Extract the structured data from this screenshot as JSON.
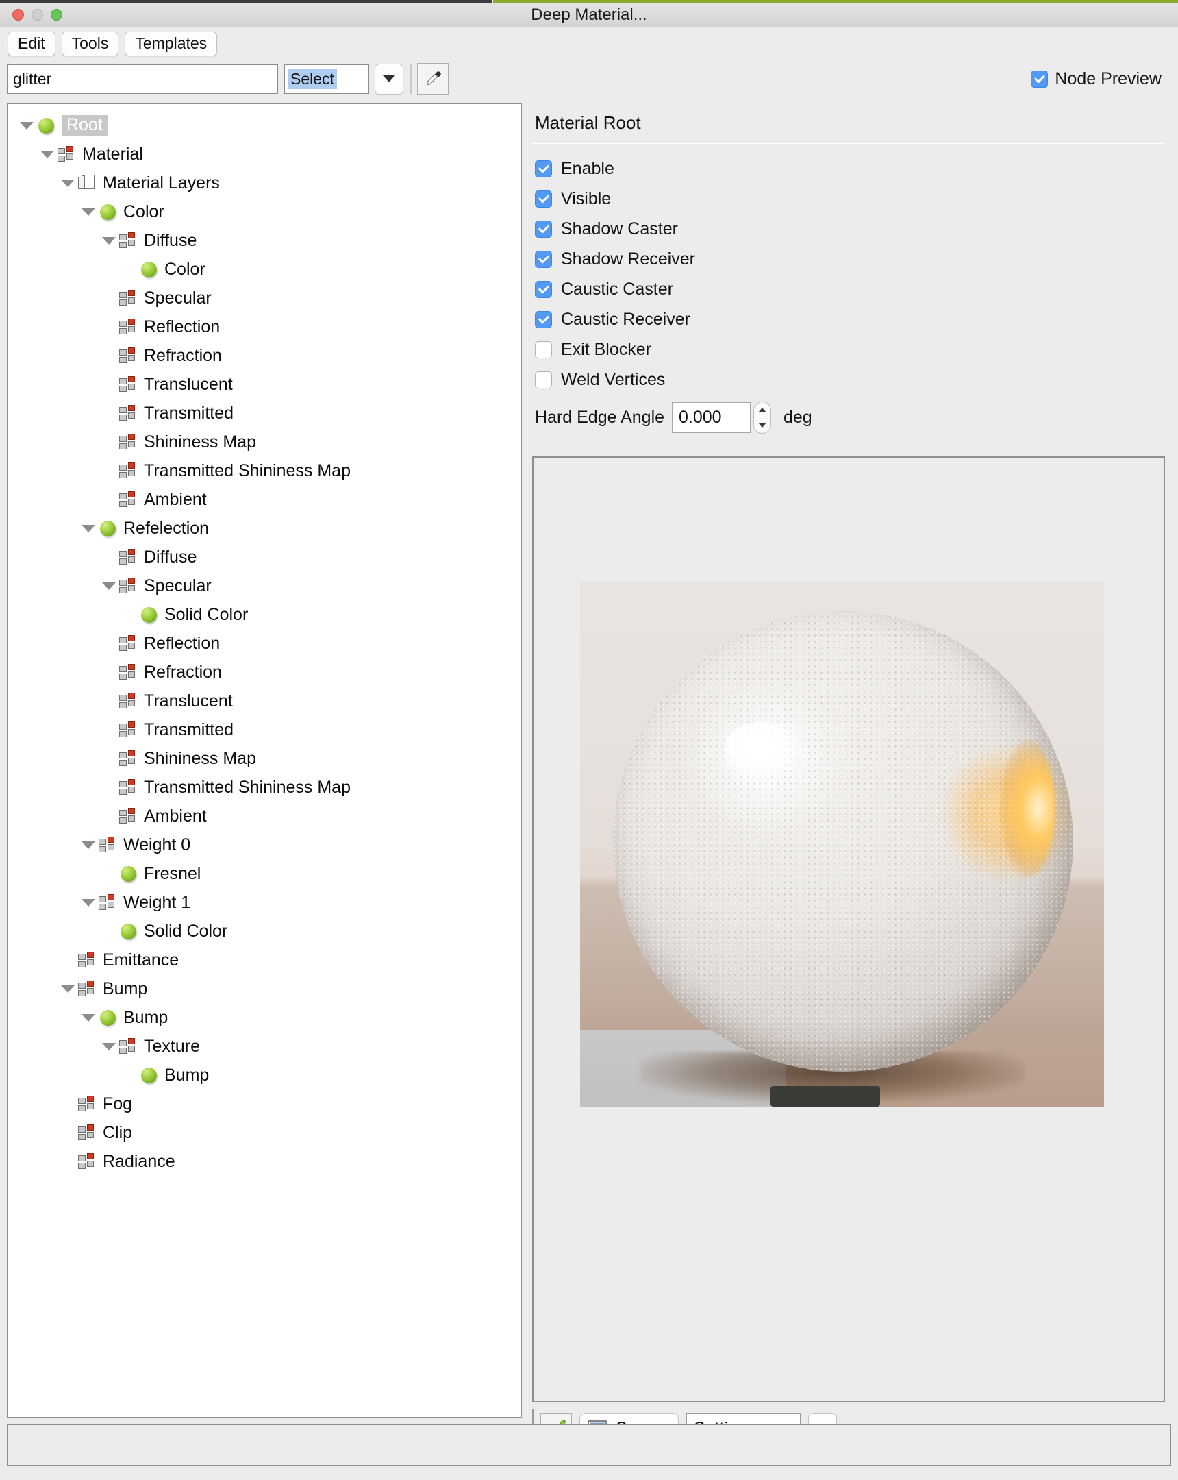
{
  "window": {
    "title": "Deep Material...",
    "controls": [
      "close",
      "minimize",
      "zoom"
    ]
  },
  "menubar": {
    "items": [
      {
        "label": "Edit"
      },
      {
        "label": "Tools"
      },
      {
        "label": "Templates"
      }
    ]
  },
  "toolbar": {
    "name_value": "glitter",
    "name_placeholder": "",
    "select_value": "Select",
    "dropdown_icon": "chevron-down-icon",
    "picker_icon": "eyedropper-icon",
    "node_preview": {
      "label": "Node Preview",
      "checked": true
    }
  },
  "tree": {
    "nodes": [
      {
        "label": "Root",
        "depth": 0,
        "icon": "sphere",
        "twisty": "open",
        "selected": true
      },
      {
        "label": "Material",
        "depth": 1,
        "icon": "grid",
        "twisty": "open",
        "selected": false
      },
      {
        "label": "Material Layers",
        "depth": 2,
        "icon": "pages",
        "twisty": "open",
        "selected": false
      },
      {
        "label": "Color",
        "depth": 3,
        "icon": "sphere",
        "twisty": "open",
        "selected": false
      },
      {
        "label": "Diffuse",
        "depth": 4,
        "icon": "grid",
        "twisty": "open",
        "selected": false
      },
      {
        "label": "Color",
        "depth": 5,
        "icon": "sphere",
        "twisty": "none",
        "selected": false
      },
      {
        "label": "Specular",
        "depth": 4,
        "icon": "grid",
        "twisty": "none",
        "selected": false
      },
      {
        "label": "Reflection",
        "depth": 4,
        "icon": "grid",
        "twisty": "none",
        "selected": false
      },
      {
        "label": "Refraction",
        "depth": 4,
        "icon": "grid",
        "twisty": "none",
        "selected": false
      },
      {
        "label": "Translucent",
        "depth": 4,
        "icon": "grid",
        "twisty": "none",
        "selected": false
      },
      {
        "label": "Transmitted",
        "depth": 4,
        "icon": "grid",
        "twisty": "none",
        "selected": false
      },
      {
        "label": "Shininess Map",
        "depth": 4,
        "icon": "grid",
        "twisty": "none",
        "selected": false
      },
      {
        "label": "Transmitted Shininess Map",
        "depth": 4,
        "icon": "grid",
        "twisty": "none",
        "selected": false
      },
      {
        "label": "Ambient",
        "depth": 4,
        "icon": "grid",
        "twisty": "none",
        "selected": false
      },
      {
        "label": "Refelection",
        "depth": 3,
        "icon": "sphere",
        "twisty": "open",
        "selected": false
      },
      {
        "label": "Diffuse",
        "depth": 4,
        "icon": "grid",
        "twisty": "none",
        "selected": false
      },
      {
        "label": "Specular",
        "depth": 4,
        "icon": "grid",
        "twisty": "open",
        "selected": false
      },
      {
        "label": "Solid Color",
        "depth": 5,
        "icon": "sphere",
        "twisty": "none",
        "selected": false
      },
      {
        "label": "Reflection",
        "depth": 4,
        "icon": "grid",
        "twisty": "none",
        "selected": false
      },
      {
        "label": "Refraction",
        "depth": 4,
        "icon": "grid",
        "twisty": "none",
        "selected": false
      },
      {
        "label": "Translucent",
        "depth": 4,
        "icon": "grid",
        "twisty": "none",
        "selected": false
      },
      {
        "label": "Transmitted",
        "depth": 4,
        "icon": "grid",
        "twisty": "none",
        "selected": false
      },
      {
        "label": "Shininess Map",
        "depth": 4,
        "icon": "grid",
        "twisty": "none",
        "selected": false
      },
      {
        "label": "Transmitted Shininess Map",
        "depth": 4,
        "icon": "grid",
        "twisty": "none",
        "selected": false
      },
      {
        "label": "Ambient",
        "depth": 4,
        "icon": "grid",
        "twisty": "none",
        "selected": false
      },
      {
        "label": "Weight 0",
        "depth": 3,
        "icon": "grid",
        "twisty": "open",
        "selected": false
      },
      {
        "label": "Fresnel",
        "depth": 4,
        "icon": "sphere",
        "twisty": "none",
        "selected": false
      },
      {
        "label": "Weight 1",
        "depth": 3,
        "icon": "grid",
        "twisty": "open",
        "selected": false
      },
      {
        "label": "Solid Color",
        "depth": 4,
        "icon": "sphere",
        "twisty": "none",
        "selected": false
      },
      {
        "label": "Emittance",
        "depth": 2,
        "icon": "grid",
        "twisty": "none",
        "selected": false
      },
      {
        "label": "Bump",
        "depth": 2,
        "icon": "grid",
        "twisty": "open",
        "selected": false
      },
      {
        "label": "Bump",
        "depth": 3,
        "icon": "sphere",
        "twisty": "open",
        "selected": false
      },
      {
        "label": "Texture",
        "depth": 4,
        "icon": "grid",
        "twisty": "open",
        "selected": false
      },
      {
        "label": "Bump",
        "depth": 5,
        "icon": "sphere",
        "twisty": "none",
        "selected": false
      },
      {
        "label": "Fog",
        "depth": 2,
        "icon": "grid",
        "twisty": "none",
        "selected": false
      },
      {
        "label": "Clip",
        "depth": 2,
        "icon": "grid",
        "twisty": "none",
        "selected": false
      },
      {
        "label": "Radiance",
        "depth": 2,
        "icon": "grid",
        "twisty": "none",
        "selected": false
      }
    ]
  },
  "properties": {
    "title": "Material Root",
    "checkboxes": [
      {
        "label": "Enable",
        "checked": true
      },
      {
        "label": "Visible",
        "checked": true
      },
      {
        "label": "Shadow Caster",
        "checked": true
      },
      {
        "label": "Shadow Receiver",
        "checked": true
      },
      {
        "label": "Caustic Caster",
        "checked": true
      },
      {
        "label": "Caustic Receiver",
        "checked": true
      },
      {
        "label": "Exit Blocker",
        "checked": false
      },
      {
        "label": "Weld Vertices",
        "checked": false
      }
    ],
    "hard_edge_angle": {
      "label": "Hard Edge Angle",
      "value": "0.000",
      "unit": "deg"
    }
  },
  "preview": {
    "subject": "textured sphere render"
  },
  "bottom_bar": {
    "ok_icon": "green-check-icon",
    "scene_icon": "list-icon",
    "scene_label": "Scene",
    "settings_value": "Settings",
    "settings_arrow_icon": "chevron-down-icon"
  },
  "statusbar": {
    "text": ""
  },
  "colors": {
    "accent_checkbox": "#539af4",
    "selection_highlight": "#aecbf0",
    "panel_background": "#ececec",
    "tree_background": "#ffffff",
    "icon_red": "#cf3a23",
    "icon_green": "#a3d341",
    "title_accent_green": "#8aab2e"
  }
}
